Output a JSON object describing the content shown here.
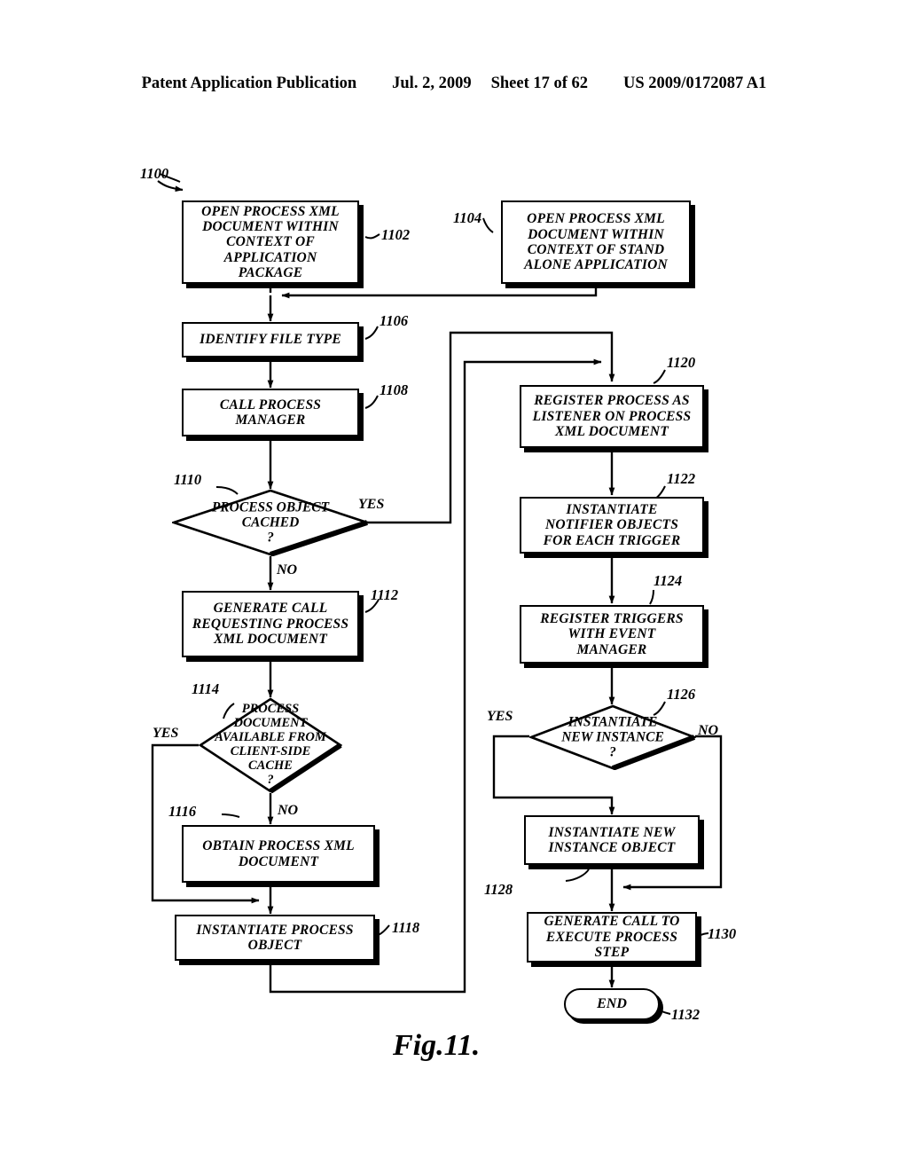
{
  "header": {
    "publication": "Patent Application Publication",
    "date": "Jul. 2, 2009",
    "sheet": "Sheet 17 of 62",
    "docnum": "US 2009/0172087 A1"
  },
  "figure": {
    "caption": "Fig.11.",
    "diagram_ref": "1100"
  },
  "nodes": {
    "n1102": {
      "ref": "1102",
      "text": "OPEN PROCESS XML\nDOCUMENT WITHIN\nCONTEXT OF\nAPPLICATION\nPACKAGE",
      "shape": "process"
    },
    "n1104": {
      "ref": "1104",
      "text": "OPEN PROCESS XML\nDOCUMENT WITHIN\nCONTEXT OF STAND\nALONE APPLICATION",
      "shape": "process"
    },
    "n1106": {
      "ref": "1106",
      "text": "IDENTIFY FILE TYPE",
      "shape": "process"
    },
    "n1108": {
      "ref": "1108",
      "text": "CALL PROCESS\nMANAGER",
      "shape": "process"
    },
    "n1110": {
      "ref": "1110",
      "text": "PROCESS OBJECT\nCACHED\n?",
      "shape": "decision"
    },
    "n1112": {
      "ref": "1112",
      "text": "GENERATE CALL\nREQUESTING PROCESS\nXML DOCUMENT",
      "shape": "process"
    },
    "n1114": {
      "ref": "1114",
      "text": "PROCESS\nDOCUMENT\nAVAILABLE FROM\nCLIENT-SIDE\nCACHE\n?",
      "shape": "decision"
    },
    "n1116": {
      "ref": "1116",
      "text": "OBTAIN PROCESS XML\nDOCUMENT",
      "shape": "process"
    },
    "n1118": {
      "ref": "1118",
      "text": "INSTANTIATE PROCESS\nOBJECT",
      "shape": "process"
    },
    "n1120": {
      "ref": "1120",
      "text": "REGISTER PROCESS AS\nLISTENER ON PROCESS\nXML DOCUMENT",
      "shape": "process"
    },
    "n1122": {
      "ref": "1122",
      "text": "INSTANTIATE\nNOTIFIER OBJECTS\nFOR EACH TRIGGER",
      "shape": "process"
    },
    "n1124": {
      "ref": "1124",
      "text": "REGISTER TRIGGERS\nWITH EVENT\nMANAGER",
      "shape": "process"
    },
    "n1126": {
      "ref": "1126",
      "text": "INSTANTIATE\nNEW INSTANCE\n?",
      "shape": "decision"
    },
    "n1128": {
      "ref": "1128",
      "text": "INSTANTIATE NEW\nINSTANCE OBJECT",
      "shape": "process"
    },
    "n1130": {
      "ref": "1130",
      "text": "GENERATE CALL TO\nEXECUTE PROCESS\nSTEP",
      "shape": "process"
    },
    "n1132": {
      "ref": "1132",
      "text": "END",
      "shape": "terminator"
    }
  },
  "branches": {
    "b1110_yes": "YES",
    "b1110_no": "NO",
    "b1114_yes": "YES",
    "b1114_no": "NO",
    "b1126_yes": "YES",
    "b1126_no": "NO"
  }
}
